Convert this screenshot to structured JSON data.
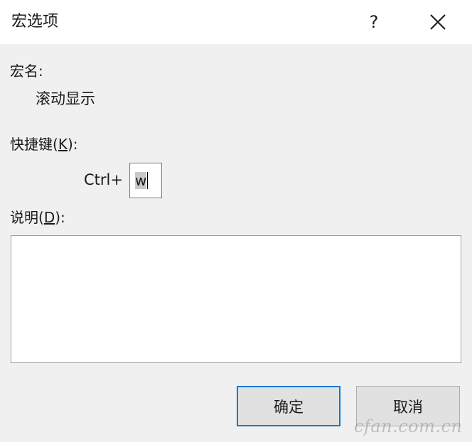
{
  "window": {
    "title": "宏选项",
    "help_symbol": "?"
  },
  "macro_name": {
    "label": "宏名:",
    "value": "滚动显示"
  },
  "shortcut": {
    "label_before": "快捷键(",
    "label_key": "K",
    "label_after": "):",
    "prefix": "Ctrl+",
    "value": "w"
  },
  "description": {
    "label_before": "说明(",
    "label_key": "D",
    "label_after": "):",
    "value": ""
  },
  "buttons": {
    "ok": "确定",
    "cancel": "取消"
  },
  "watermark": "cfan.com.cn"
}
